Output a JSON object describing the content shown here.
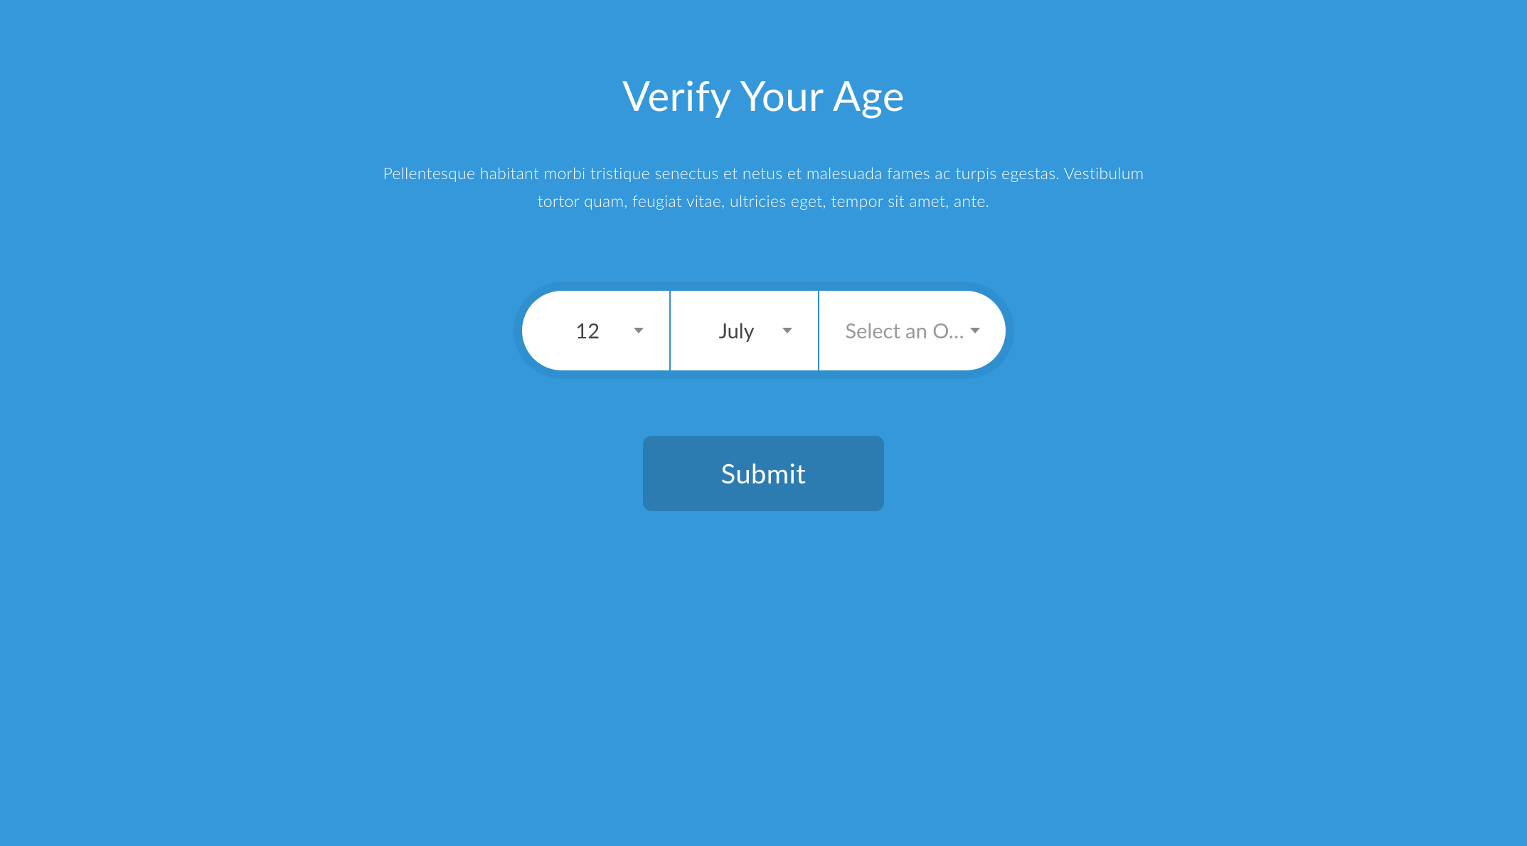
{
  "header": {
    "title": "Verify Your Age",
    "description": "Pellentesque habitant morbi tristique senectus et netus et malesuada fames ac turpis egestas. Vestibulum tortor quam, feugiat vitae, ultricies eget, tempor sit amet, ante."
  },
  "form": {
    "day": {
      "value": "12"
    },
    "month": {
      "value": "July"
    },
    "year": {
      "value": "Select an O…",
      "is_placeholder": true
    },
    "submit_label": "Submit"
  },
  "colors": {
    "bg": "#3498db",
    "button": "#2c7cb1",
    "divider": "#2f90d1"
  }
}
